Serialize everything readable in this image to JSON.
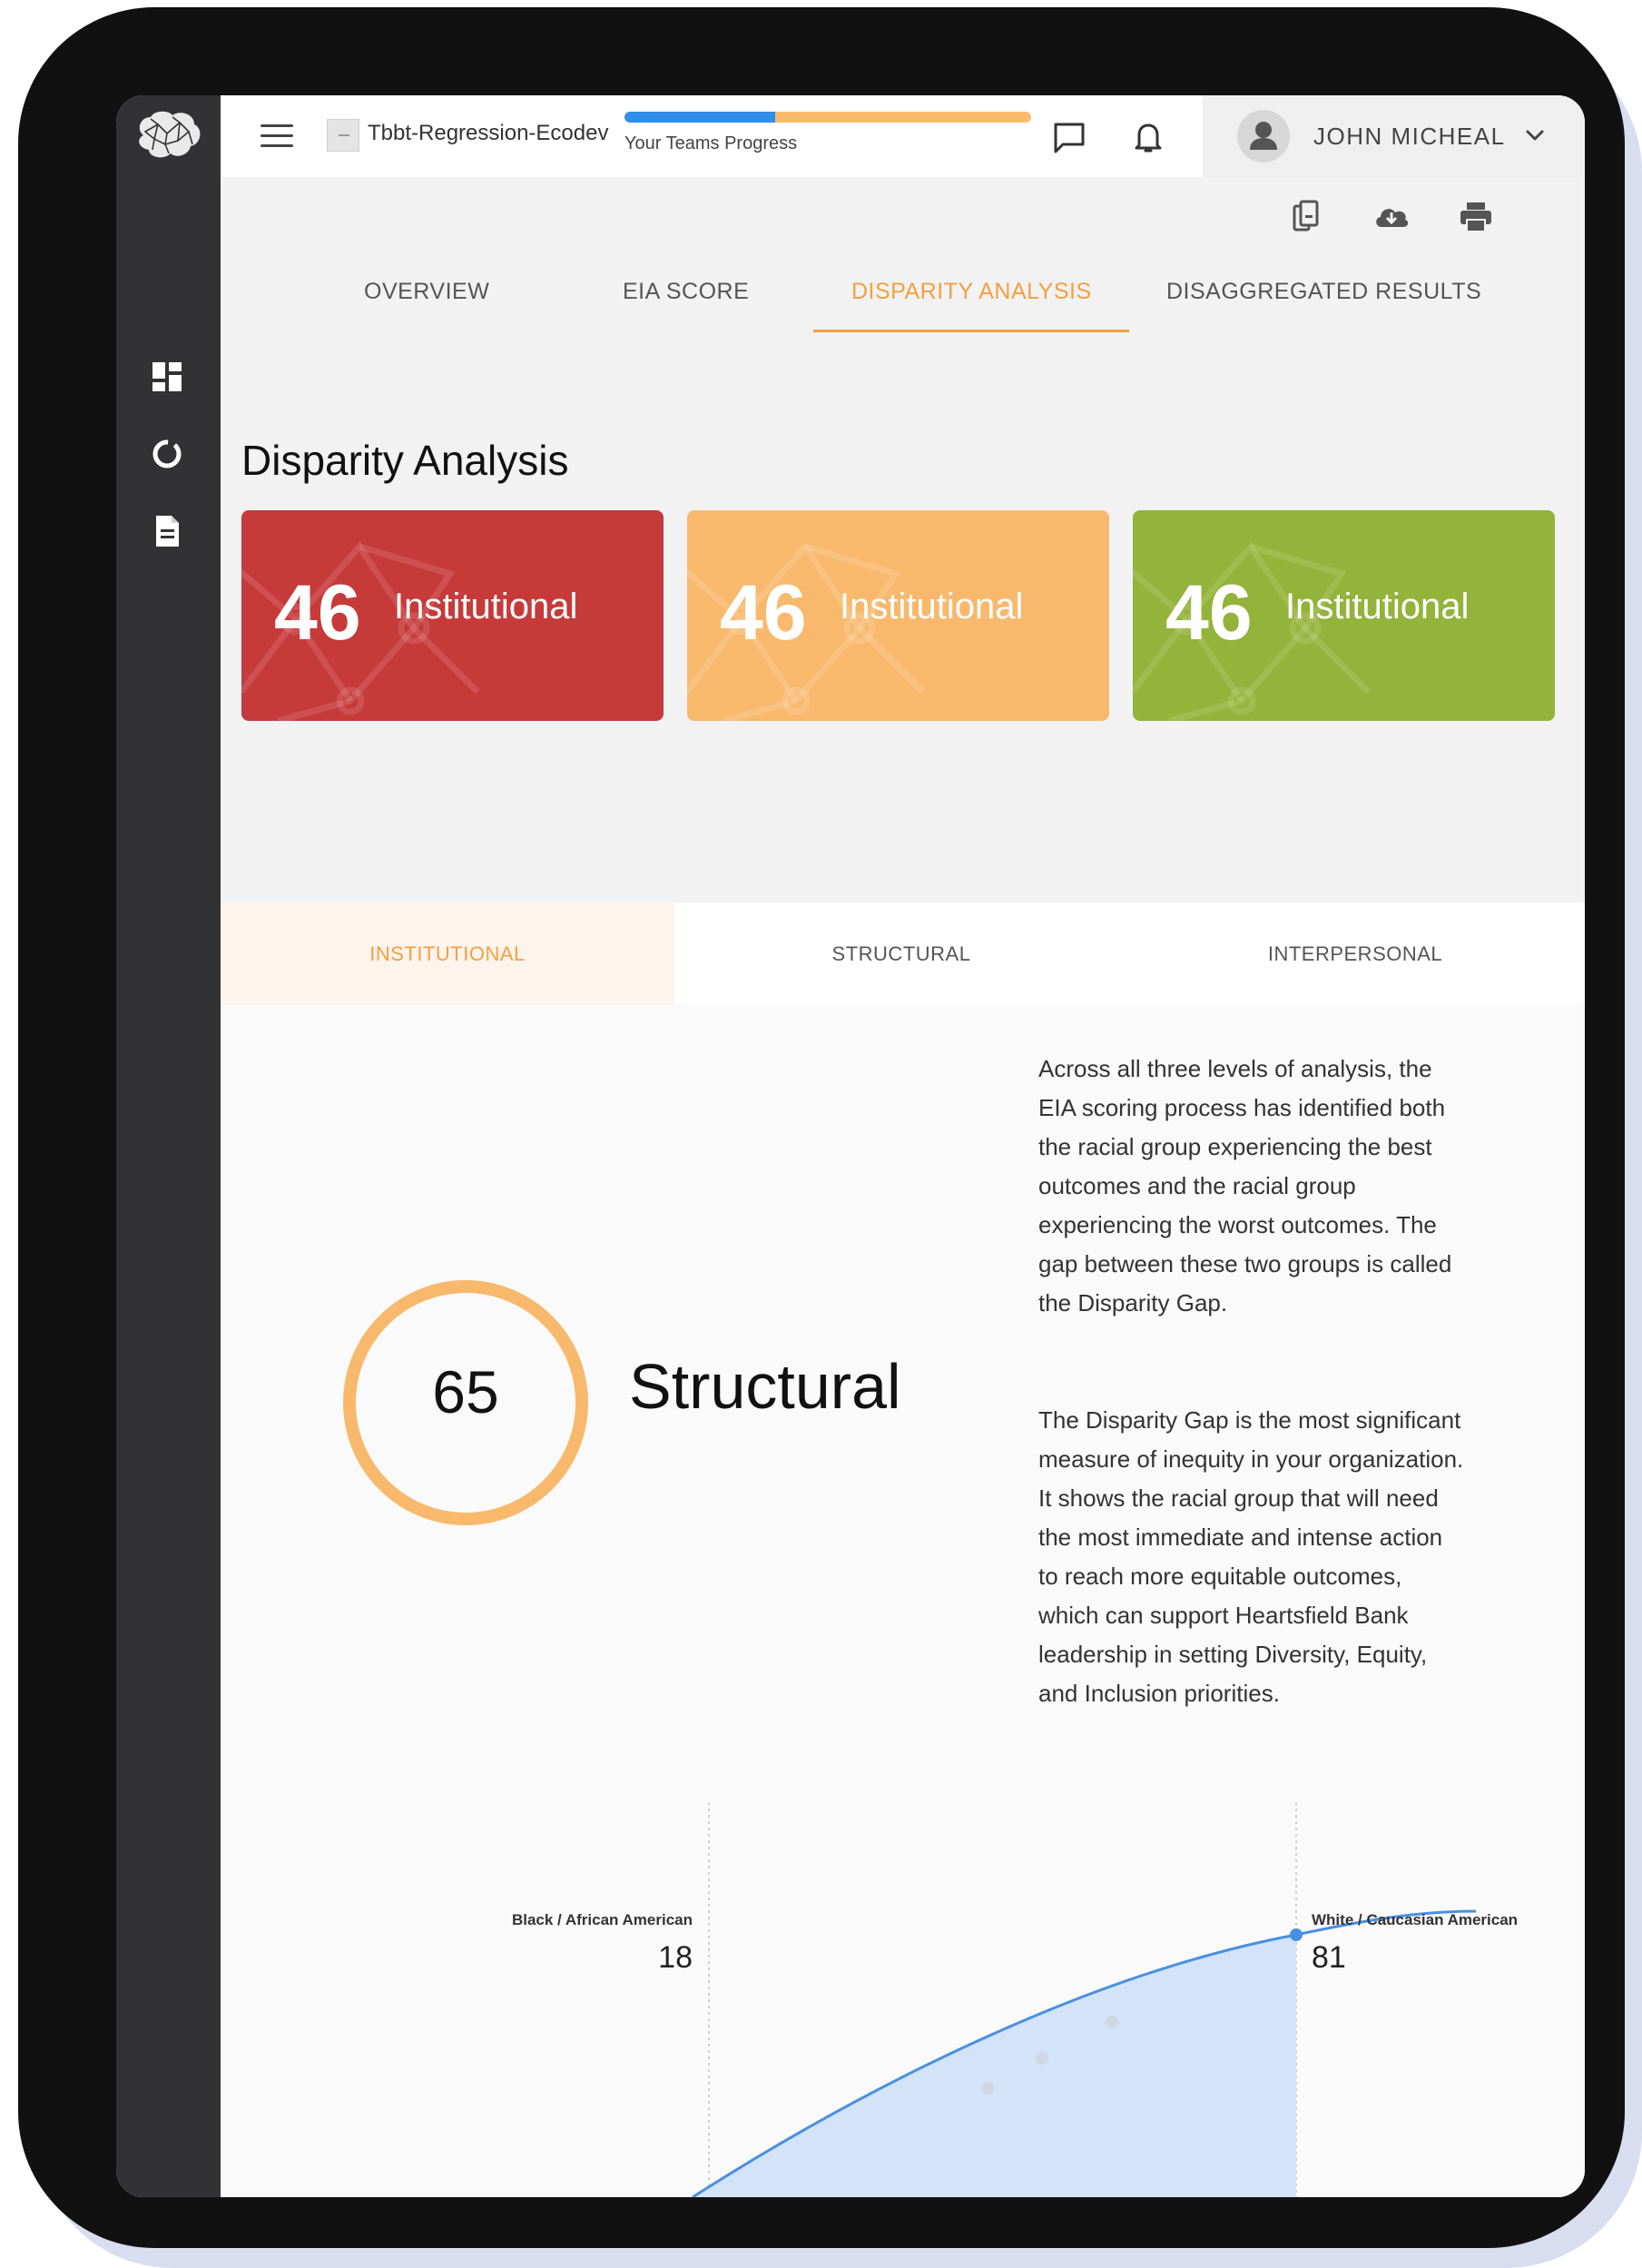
{
  "header": {
    "project_name": "Tbbt-Regression-Ecodev",
    "progress_label": "Your Teams Progress",
    "progress_fraction": 0.37,
    "user_name": "JOHN MICHEAL"
  },
  "tabs": [
    {
      "label": "OVERVIEW"
    },
    {
      "label": "EIA SCORE"
    },
    {
      "label": "DISPARITY ANALYSIS"
    },
    {
      "label": "DISAGGREGATED RESULTS"
    }
  ],
  "section_title": "Disparity Analysis",
  "cards": [
    {
      "value": "46",
      "label": "Institutional",
      "color": "#c73a3a"
    },
    {
      "value": "46",
      "label": "Institutional",
      "color": "#f8b96d"
    },
    {
      "value": "46",
      "label": "Institutional",
      "color": "#93b33a"
    }
  ],
  "level_tabs": [
    {
      "label": "INSTITUTIONAL"
    },
    {
      "label": "STRUCTURAL"
    },
    {
      "label": "INTERPERSONAL"
    }
  ],
  "gauge": {
    "value": "65",
    "label": "Structural",
    "color": "#f8b96d"
  },
  "description": {
    "paragraph1": "Across all three levels of analysis, the EIA scoring process has identified both the racial group experiencing the best outcomes and the racial group experiencing the worst outcomes. The gap between these two groups is called the Disparity Gap.",
    "paragraph2": "The Disparity Gap is the most significant measure of inequity in your organization. It shows the racial group that will need the most immediate and intense action to reach more equitable outcomes, which can support Heartsfield Bank leadership in setting Diversity, Equity, and Inclusion priorities."
  },
  "chart": {
    "low_group": "Black / African American",
    "low_value": "18",
    "high_group": "White / Caucasian American",
    "high_value": "81"
  },
  "colors": {
    "accent": "#f4a040",
    "rail": "#323235",
    "progress_blue": "#2f8ee8",
    "chart_line": "#4a90e2",
    "chart_fill": "#d3e3f8"
  }
}
